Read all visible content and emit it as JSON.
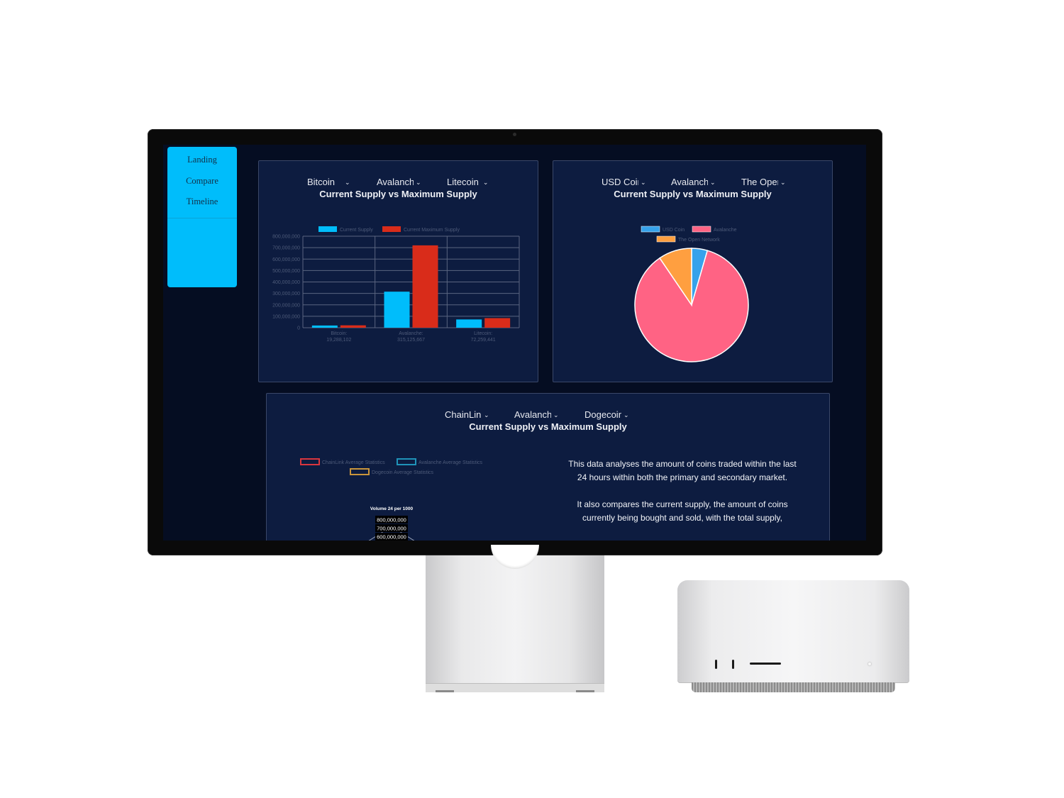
{
  "sidebar": {
    "items": [
      {
        "label": "Landing"
      },
      {
        "label": "Compare"
      },
      {
        "label": "Timeline"
      }
    ]
  },
  "panel1": {
    "selects": [
      "Bitcoin",
      "Avalanche",
      "Litecoin"
    ],
    "title": "Current Supply vs Maximum Supply"
  },
  "panel2": {
    "selects": [
      "USD Coin",
      "Avalanche",
      "The Open Network"
    ],
    "title": "Current Supply vs Maximum Supply"
  },
  "panel3": {
    "selects": [
      "ChainLink",
      "Avalanche",
      "Dogecoin"
    ],
    "title": "Current Supply vs Maximum Supply",
    "description": [
      "This data analyses the amount of coins traded within the last 24 hours within both the primary and secondary market.",
      "It also compares the current supply, the amount of coins currently being bought and sold, with the total supply,"
    ]
  },
  "chart_data": [
    {
      "type": "bar",
      "categories": [
        "Bitcoin:\n19,288,102",
        "Avalanche:\n315,125,667",
        "Litecoin:\n72,259,441"
      ],
      "series": [
        {
          "name": "Current Supply",
          "values": [
            19288102,
            315125667,
            72259441
          ],
          "color": "#00bdfb"
        },
        {
          "name": "Current Maximum Supply",
          "values": [
            21000000,
            720000000,
            84000000
          ],
          "color": "#d92c1a"
        }
      ],
      "ylim": [
        0,
        800000000
      ],
      "yticks": [
        "0",
        "100,000,000",
        "200,000,000",
        "300,000,000",
        "400,000,000",
        "500,000,000",
        "600,000,000",
        "700,000,000",
        "800,000,000"
      ],
      "legend": "top",
      "grid": true
    },
    {
      "type": "pie",
      "labels": [
        "USD Coin",
        "Avalanche",
        "The Open Network"
      ],
      "values": [
        4.5,
        86.0,
        9.5
      ],
      "colors": [
        "#36a2eb",
        "#ff6384",
        "#ff9f40"
      ],
      "legend": "top"
    },
    {
      "type": "radar",
      "series": [
        {
          "name": "ChainLink Average Statistics",
          "color": "#d9363e"
        },
        {
          "name": "Avalanche Average Statistics",
          "color": "#1f93b9"
        },
        {
          "name": "Dogecoin Average Statistics",
          "color": "#c9953b"
        }
      ],
      "axis_title": "Volume 24 per 1000",
      "ticks": [
        "800,000,000",
        "700,000,000",
        "600,000,000"
      ],
      "legend": "top"
    }
  ]
}
